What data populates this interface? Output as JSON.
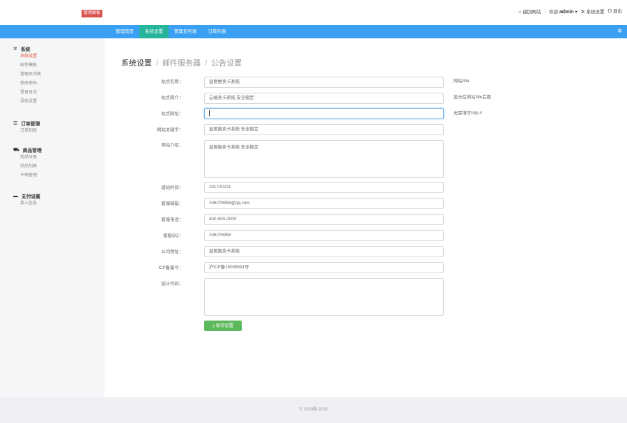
{
  "brand": {
    "badge": "管理面板"
  },
  "topnav": {
    "home": "返回网站",
    "sep": "|",
    "welcome": "欢迎",
    "username": "admin",
    "settings": "系统设置",
    "logout": "退出"
  },
  "nav": {
    "tabs": [
      "管理首页",
      "系统设置",
      "管理员列表",
      "订单列表"
    ]
  },
  "sidebar": {
    "system": {
      "title": "系统",
      "items": [
        "系统设置",
        "邮件模板",
        "管理员列表",
        "修改密码",
        "登录日志",
        "导航设置"
      ]
    },
    "orders": {
      "title": "订单管理",
      "items": [
        "订单列表"
      ]
    },
    "goods": {
      "title": "商品管理",
      "items": [
        "商品分类",
        "商品列表",
        "卡密管理"
      ]
    },
    "pay": {
      "title": "支付设置",
      "items": [
        "接入信息"
      ]
    }
  },
  "breadcrumb": {
    "a": "系统设置",
    "b": "邮件服务器",
    "c": "公告设置",
    "slash": "/"
  },
  "form": {
    "site_name": {
      "label": "站点名称：",
      "value": "鼠要推卖卡系统"
    },
    "site_intro": {
      "label": "站点简介：",
      "value": "云端卖卡系统 安全稳定"
    },
    "site_url": {
      "label": "站点网址：",
      "value": ""
    },
    "keywords": {
      "label": "网站关键字：",
      "value": "鼠要推卖卡系统 安全稳定"
    },
    "description": {
      "label": "网站介绍：",
      "value": "鼠要推卖卡系统 安全稳定"
    },
    "founded": {
      "label": "建站时间：",
      "value": "2017/03/21"
    },
    "email": {
      "label": "客服邮箱：",
      "value": "206278958@qq.com"
    },
    "phone": {
      "label": "客服电话：",
      "value": "400-000-0000"
    },
    "qq": {
      "label": "客服QQ：",
      "value": "206278958"
    },
    "address": {
      "label": "公司地址：",
      "value": "鼠要推卖卡系统"
    },
    "icp": {
      "label": "ICP备案号：",
      "value": "沪ICP备15008591号"
    },
    "stats": {
      "label": "统计代码：",
      "value": ""
    }
  },
  "hints": {
    "site_name": "网站title",
    "site_intro": "显示在网站title后面",
    "site_url": "无需填写http://"
  },
  "save_button": "保存设置",
  "footer": "© 2018版 2019"
}
